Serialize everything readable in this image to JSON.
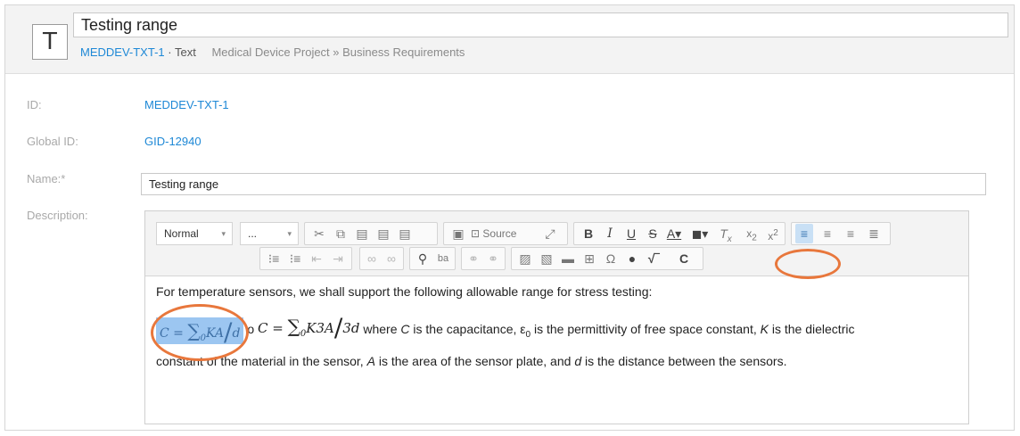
{
  "header": {
    "type_icon_glyph": "T",
    "title": "Testing range",
    "item_id": "MEDDEV-TXT-1",
    "separator": "·",
    "item_type": "Text",
    "path": "Medical Device Project » Business Requirements"
  },
  "fields": {
    "id_label": "ID:",
    "id_value": "MEDDEV-TXT-1",
    "global_id_label": "Global ID:",
    "global_id_value": "GID-12940",
    "name_label": "Name:*",
    "name_value": "Testing range",
    "description_label": "Description:"
  },
  "toolbar": {
    "format_value": "Normal",
    "font_value": "...",
    "dropdown_arrow": "▾",
    "source_label": "Source",
    "icons_row1": [
      "cut-icon",
      "copy-icon",
      "paste-icon",
      "paste-text-icon",
      "paste-word-icon",
      "templates-icon",
      "source-icon",
      "maximize-icon",
      "bold-icon",
      "italic-icon",
      "underline-icon",
      "strike-icon",
      "text-color-icon",
      "bg-color-icon",
      "remove-format-icon",
      "subscript-icon",
      "superscript-icon",
      "align-left-icon",
      "align-center-icon",
      "align-right-icon",
      "justify-icon"
    ],
    "icons_row2": [
      "numbered-list-icon",
      "bulleted-list-icon",
      "outdent-icon",
      "indent-icon",
      "link-icon",
      "unlink-icon",
      "find-icon",
      "replace-icon",
      "anchor-icon",
      "unanchor-icon",
      "insert-image-icon",
      "insert-file-icon",
      "folder-icon",
      "table-icon",
      "special-char-icon",
      "accessibility-icon",
      "math-icon",
      "custom-c-icon"
    ],
    "highlight_color": "#e8773c"
  },
  "content": {
    "line1": "For temperature sensors, we shall support the following allowable range for stress testing:",
    "sel_c": "C",
    "sel_eq": "=",
    "sel_sum": "∑",
    "sel_sub": "0",
    "sel_ka": "KA",
    "sel_d": "d",
    "fragment": "o",
    "f_c": "C",
    "f_eq": "=",
    "f_sum": "∑",
    "f_sub": "0",
    "f_k3a": "K3A",
    "f_3d": "3d",
    "l2_where": "where",
    "l2_c": "C",
    "l2_a": "is the capacitance, ε",
    "l2_sub": "0",
    "l2_b": "is the permittivity of free space constant,",
    "l2_k": "K",
    "l2_c2": "is the dielectric",
    "l3_a": "constant of the material in the sensor,",
    "l3_A": "A",
    "l3_b": "is the area of the sensor plate, and",
    "l3_d": "d",
    "l3_c": "is the distance between the sensors."
  }
}
